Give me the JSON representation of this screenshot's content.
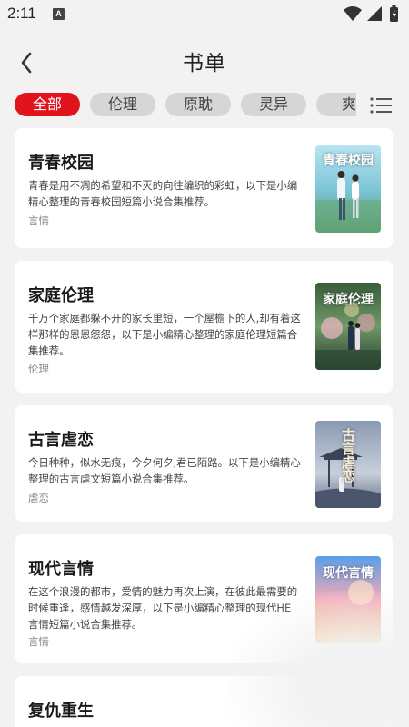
{
  "status_bar": {
    "time": "2:11",
    "notification_glyph": "A"
  },
  "header": {
    "title": "书单"
  },
  "tabs": [
    {
      "label": "全部",
      "active": true
    },
    {
      "label": "伦理",
      "active": false
    },
    {
      "label": "原耽",
      "active": false
    },
    {
      "label": "灵异",
      "active": false
    },
    {
      "label": "爽",
      "active": false
    }
  ],
  "cards": [
    {
      "title": "青春校园",
      "desc": "青春是用不凋的希望和不灭的向往编织的彩虹，以下是小编精心整理的青春校园短篇小说合集推荐。",
      "tag": "言情",
      "cover_text": "青春校园"
    },
    {
      "title": "家庭伦理",
      "desc": "千万个家庭都躲不开的家长里短，一个屋檐下的人,却有着这样那样的恩恩怨怨，以下是小编精心整理的家庭伦理短篇合集推荐。",
      "tag": "伦理",
      "cover_text": "家庭伦理"
    },
    {
      "title": "古言虐恋",
      "desc": "今日种种，似水无痕，今夕何夕,君已陌路。以下是小编精心整理的古言虐文短篇小说合集推荐。",
      "tag": "虐恋",
      "cover_text": "古言虐恋"
    },
    {
      "title": "现代言情",
      "desc": "在这个浪漫的都市，爱情的魅力再次上演，在彼此最需要的时候重逢，感情越发深厚，以下是小编精心整理的现代HE言情短篇小说合集推荐。",
      "tag": "言情",
      "cover_text": "现代言情"
    },
    {
      "title": "复仇重生",
      "desc": "",
      "tag": "",
      "cover_text": ""
    }
  ],
  "colors": {
    "accent": "#e1141e",
    "background": "#f2f2f2",
    "tab_inactive": "#d6d6d6"
  }
}
